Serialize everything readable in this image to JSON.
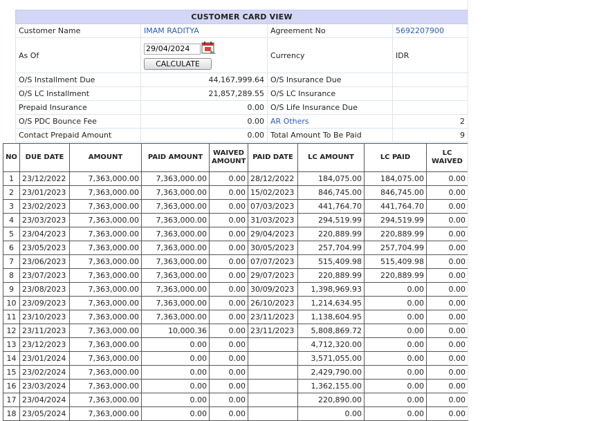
{
  "card": {
    "title": "CUSTOMER CARD VIEW",
    "customer_name_label": "Customer Name",
    "customer_name": "IMAM RADITYA",
    "agreement_no_label": "Agreement No",
    "agreement_no": "5692207900",
    "as_of_label": "As Of",
    "as_of_value": "29/04/2024",
    "calculate_label": "CALCULATE",
    "currency_label": "Currency",
    "currency": "IDR",
    "os_installment_due_label": "O/S Installment Due",
    "os_installment_due": "44,167,999.64",
    "os_insurance_due_label": "O/S Insurance Due",
    "os_insurance_due": "",
    "os_lc_installment_label": "O/S LC Installment",
    "os_lc_installment": "21,857,289.55",
    "os_lc_insurance_label": "O/S LC Insurance",
    "os_lc_insurance": "",
    "prepaid_insurance_label": "Prepaid Insurance",
    "prepaid_insurance": "0.00",
    "os_life_insurance_due_label": "O/S Life Insurance Due",
    "os_life_insurance_due": "",
    "os_pdc_bounce_fee_label": "O/S PDC Bounce Fee",
    "os_pdc_bounce_fee": "0.00",
    "ar_others_label": "AR Others",
    "ar_others": "2",
    "contact_prepaid_amount_label": "Contact Prepaid Amount",
    "contact_prepaid_amount": "0.00",
    "total_amount_label": "Total Amount To Be Paid",
    "total_amount": "9"
  },
  "grid": {
    "headers": [
      "NO",
      "DUE DATE",
      "AMOUNT",
      "PAID AMOUNT",
      "WAIVED AMOUNT",
      "PAID DATE",
      "LC AMOUNT",
      "LC PAID",
      "LC WAIVED"
    ],
    "rows": [
      [
        "1",
        "23/12/2022",
        "7,363,000.00",
        "7,363,000.00",
        "0.00",
        "28/12/2022",
        "184,075.00",
        "184,075.00",
        "0.00"
      ],
      [
        "2",
        "23/01/2023",
        "7,363,000.00",
        "7,363,000.00",
        "0.00",
        "15/02/2023",
        "846,745.00",
        "846,745.00",
        "0.00"
      ],
      [
        "3",
        "23/02/2023",
        "7,363,000.00",
        "7,363,000.00",
        "0.00",
        "07/03/2023",
        "441,764.70",
        "441,764.70",
        "0.00"
      ],
      [
        "4",
        "23/03/2023",
        "7,363,000.00",
        "7,363,000.00",
        "0.00",
        "31/03/2023",
        "294,519.99",
        "294,519.99",
        "0.00"
      ],
      [
        "5",
        "23/04/2023",
        "7,363,000.00",
        "7,363,000.00",
        "0.00",
        "29/04/2023",
        "220,889.99",
        "220,889.99",
        "0.00"
      ],
      [
        "6",
        "23/05/2023",
        "7,363,000.00",
        "7,363,000.00",
        "0.00",
        "30/05/2023",
        "257,704.99",
        "257,704.99",
        "0.00"
      ],
      [
        "7",
        "23/06/2023",
        "7,363,000.00",
        "7,363,000.00",
        "0.00",
        "07/07/2023",
        "515,409.98",
        "515,409.98",
        "0.00"
      ],
      [
        "8",
        "23/07/2023",
        "7,363,000.00",
        "7,363,000.00",
        "0.00",
        "29/07/2023",
        "220,889.99",
        "220,889.99",
        "0.00"
      ],
      [
        "9",
        "23/08/2023",
        "7,363,000.00",
        "7,363,000.00",
        "0.00",
        "30/09/2023",
        "1,398,969.93",
        "0.00",
        "0.00"
      ],
      [
        "10",
        "23/09/2023",
        "7,363,000.00",
        "7,363,000.00",
        "0.00",
        "26/10/2023",
        "1,214,634.95",
        "0.00",
        "0.00"
      ],
      [
        "11",
        "23/10/2023",
        "7,363,000.00",
        "7,363,000.00",
        "0.00",
        "23/11/2023",
        "1,138,604.95",
        "0.00",
        "0.00"
      ],
      [
        "12",
        "23/11/2023",
        "7,363,000.00",
        "10,000.36",
        "0.00",
        "23/11/2023",
        "5,808,869.72",
        "0.00",
        "0.00"
      ],
      [
        "13",
        "23/12/2023",
        "7,363,000.00",
        "0.00",
        "0.00",
        "",
        "4,712,320.00",
        "0.00",
        "0.00"
      ],
      [
        "14",
        "23/01/2024",
        "7,363,000.00",
        "0.00",
        "0.00",
        "",
        "3,571,055.00",
        "0.00",
        "0.00"
      ],
      [
        "15",
        "23/02/2024",
        "7,363,000.00",
        "0.00",
        "0.00",
        "",
        "2,429,790.00",
        "0.00",
        "0.00"
      ],
      [
        "16",
        "23/03/2024",
        "7,363,000.00",
        "0.00",
        "0.00",
        "",
        "1,362,155.00",
        "0.00",
        "0.00"
      ],
      [
        "17",
        "23/04/2024",
        "7,363,000.00",
        "0.00",
        "0.00",
        "",
        "220,890.00",
        "0.00",
        "0.00"
      ],
      [
        "18",
        "23/05/2024",
        "7,363,000.00",
        "0.00",
        "0.00",
        "",
        "0.00",
        "0.00",
        "0.00"
      ]
    ]
  },
  "icons": {
    "calendar": "calendar-icon"
  },
  "colors": {
    "title_bg": "#d3d6f4",
    "link": "#2a5db0",
    "label_bg": "#f3f4f9"
  }
}
